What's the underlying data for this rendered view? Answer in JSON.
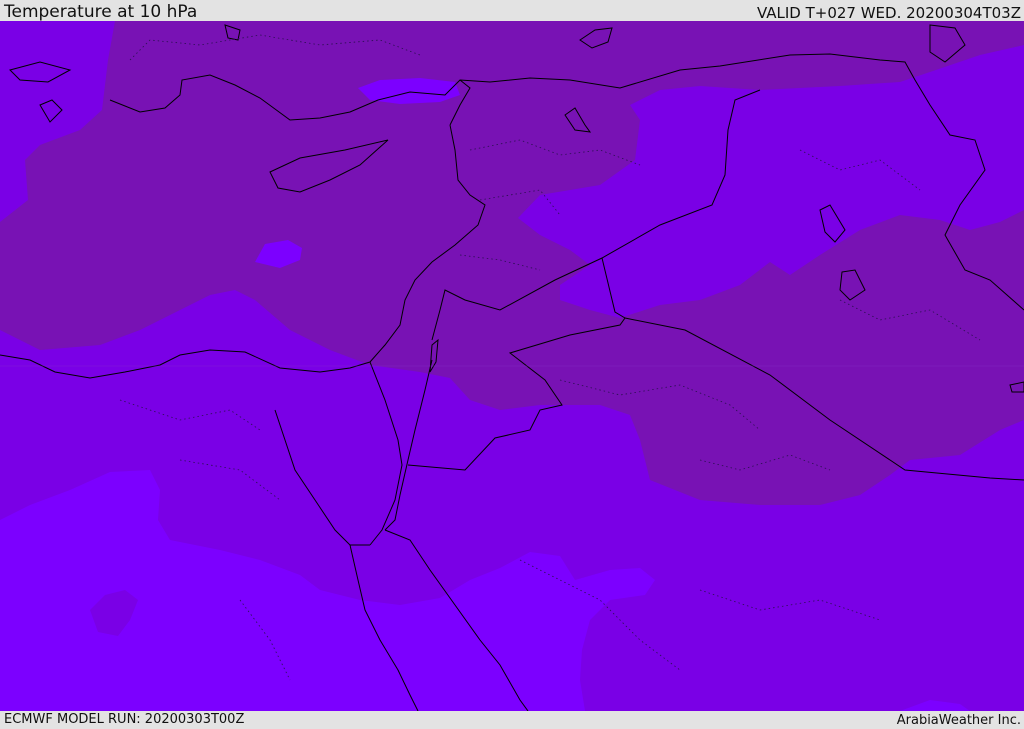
{
  "header": {
    "title": "Temperature at 10 hPa",
    "valid_time": "VALID T+027 WED. 20200304T03Z"
  },
  "footer": {
    "model_run": "ECMWF MODEL RUN: 20200303T00Z",
    "credit": "ArabiaWeather Inc."
  },
  "map": {
    "field": "Temperature",
    "level": "10 hPa",
    "colors": {
      "dark_band": "#7812b4",
      "mid_band": "#7a00e6",
      "light_band": "#7c00ff",
      "coastline": "#000000",
      "header_bg": "#e3e3e3"
    }
  }
}
